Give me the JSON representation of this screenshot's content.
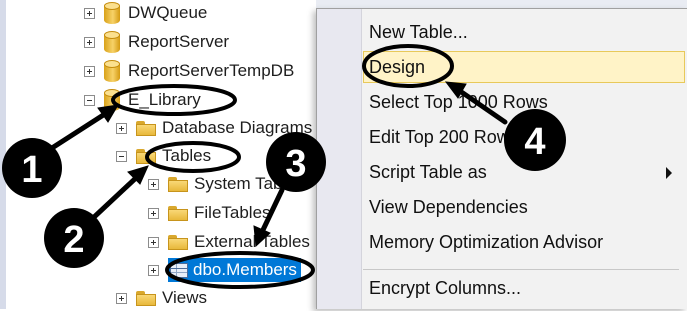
{
  "tree": {
    "items": [
      {
        "label": "DWQueue",
        "icon": "database-icon",
        "expander": "plus"
      },
      {
        "label": "ReportServer",
        "icon": "database-icon",
        "expander": "plus"
      },
      {
        "label": "ReportServerTempDB",
        "icon": "database-icon",
        "expander": "plus"
      },
      {
        "label": "E_Library",
        "icon": "database-icon",
        "expander": "minus"
      },
      {
        "label": "Database Diagrams",
        "icon": "folder-icon",
        "expander": "plus"
      },
      {
        "label": "Tables",
        "icon": "folder-icon",
        "expander": "minus"
      },
      {
        "label": "System Tables",
        "icon": "folder-icon",
        "expander": "plus"
      },
      {
        "label": "FileTables",
        "icon": "folder-icon",
        "expander": "plus"
      },
      {
        "label": "External Tables",
        "icon": "folder-icon",
        "expander": "plus"
      },
      {
        "label": "dbo.Members",
        "icon": "table-icon",
        "expander": "plus",
        "selected": true
      },
      {
        "label": "Views",
        "icon": "folder-icon",
        "expander": "plus"
      }
    ]
  },
  "context_menu": {
    "items": [
      {
        "label": "New Table..."
      },
      {
        "label": "Design",
        "highlighted": true
      },
      {
        "label": "Select Top 1000 Rows"
      },
      {
        "label": "Edit Top 200 Rows"
      },
      {
        "label": "Script Table as",
        "has_submenu": true
      },
      {
        "label": "View Dependencies"
      },
      {
        "label": "Memory Optimization Advisor"
      },
      {
        "label": "Encrypt Columns..."
      }
    ]
  },
  "annotations": {
    "badges": [
      "1",
      "2",
      "3",
      "4"
    ],
    "callout_color": "#000000"
  },
  "colors": {
    "selection": "#0078d7",
    "menu_highlight": "#fff3c7",
    "menu_background": "#f2f2f2"
  }
}
